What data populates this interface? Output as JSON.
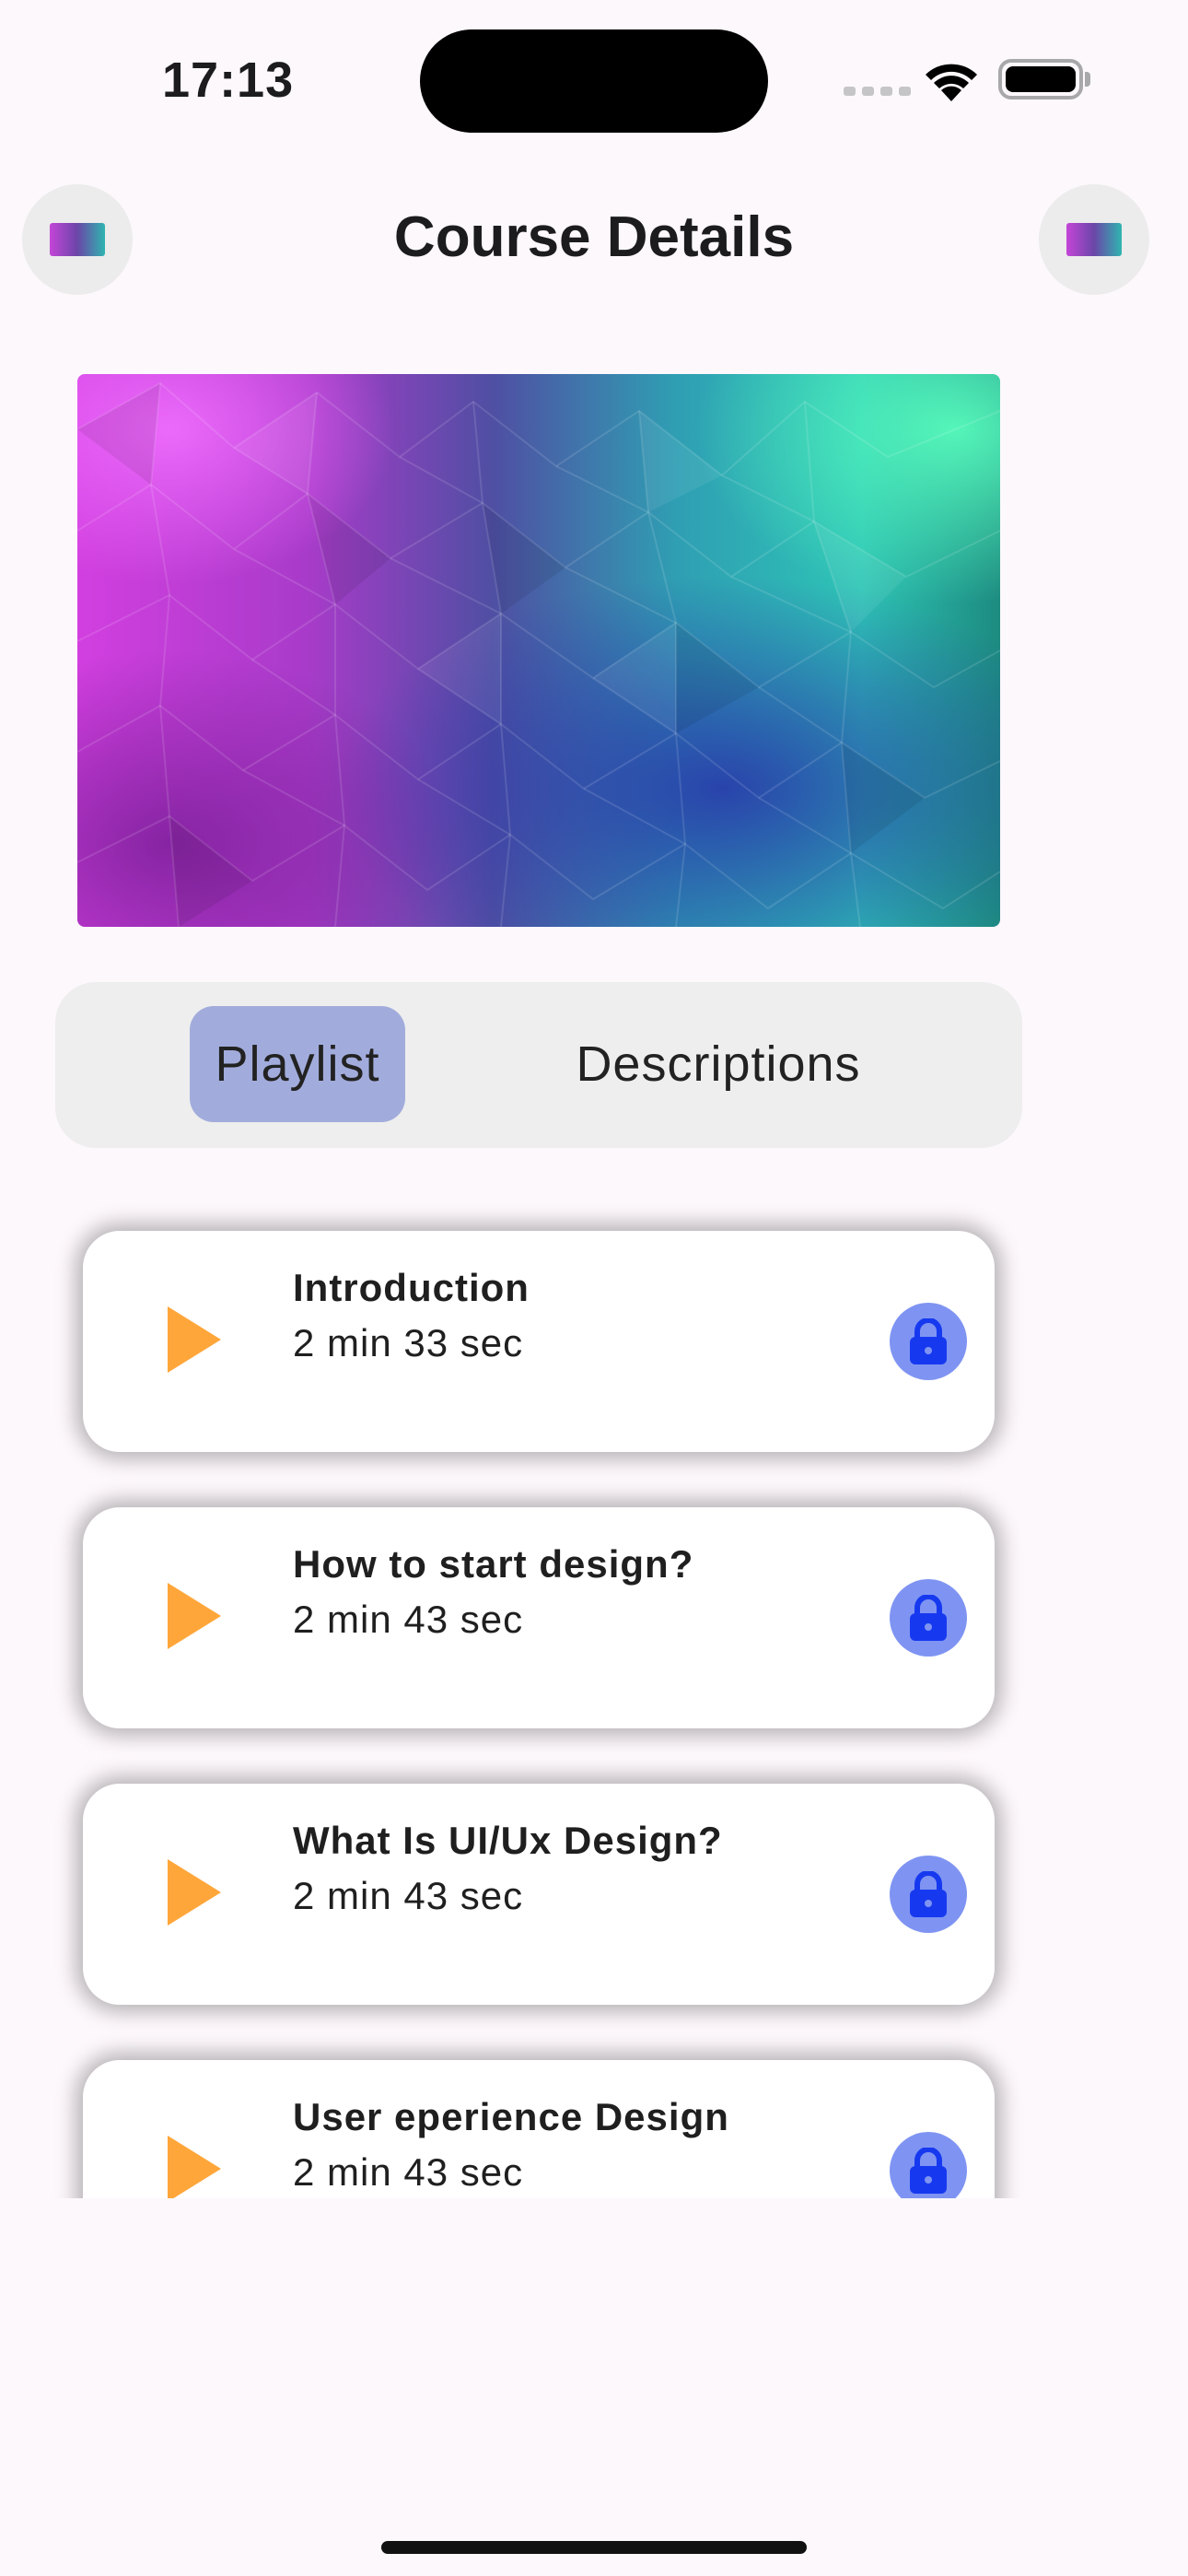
{
  "status_bar": {
    "time": "17:13"
  },
  "header": {
    "title": "Course Details",
    "left_button_icon": "course-thumbnail-icon",
    "right_button_icon": "course-thumbnail-icon"
  },
  "banner": {
    "description": "colorful low-poly gradient image",
    "colors": [
      "#d23fe0",
      "#4f4fa3",
      "#2ec4b6"
    ]
  },
  "tabs": {
    "active": "Playlist",
    "items": [
      {
        "label": "Playlist",
        "selected": true
      },
      {
        "label": "Descriptions",
        "selected": false
      }
    ]
  },
  "playlist": [
    {
      "title": "Introduction",
      "duration": "2 min 33 sec",
      "icon": "play-icon",
      "status_icon": "lock-icon"
    },
    {
      "title": "How to start design?",
      "duration": "2 min 43 sec",
      "icon": "play-icon",
      "status_icon": "lock-icon"
    },
    {
      "title": "What Is UI/Ux Design?",
      "duration": "2 min 43 sec",
      "icon": "play-icon",
      "status_icon": "lock-icon"
    },
    {
      "title": "User eperience Design",
      "duration": "2 min 43 sec",
      "icon": "play-icon",
      "status_icon": "lock-icon"
    }
  ],
  "colors": {
    "accent_play": "#ffa63a",
    "lock_badge": "#7f94f2",
    "lock_icon": "#1639f0",
    "tab_active": "#a2acdc"
  }
}
